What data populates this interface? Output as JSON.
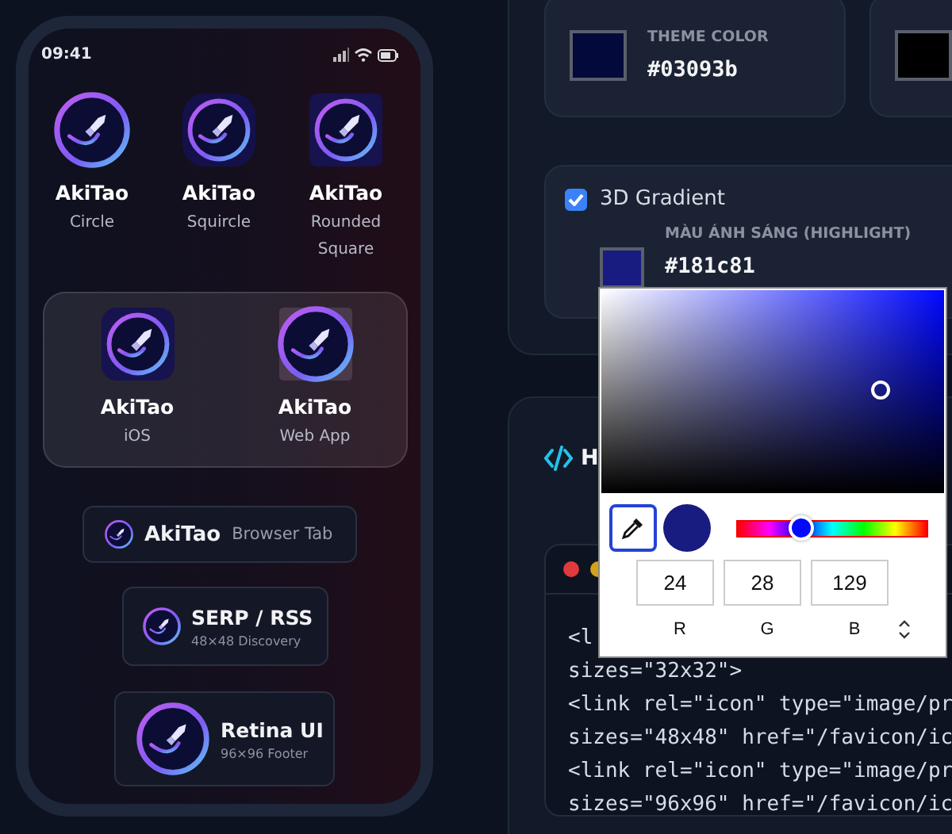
{
  "phone": {
    "time": "09:41",
    "icon_grid": [
      {
        "name": "AkiTao",
        "caption": "Circle",
        "kind": "circle"
      },
      {
        "name": "AkiTao",
        "caption": "Squircle",
        "kind": "squircle"
      },
      {
        "name": "AkiTao",
        "caption": "Rounded Square",
        "kind": "rounded"
      }
    ],
    "platform_group": [
      {
        "name": "AkiTao",
        "caption": "iOS",
        "kind": "ios"
      },
      {
        "name": "AkiTao",
        "caption": "Web App",
        "kind": "webapp"
      }
    ],
    "browser_tab": {
      "name": "AkiTao",
      "caption": "Browser Tab"
    },
    "previews": [
      {
        "title": "SERP / RSS",
        "caption": "48×48 Discovery",
        "kind": "medium"
      },
      {
        "title": "Retina UI",
        "caption": "96×96 Footer",
        "kind": "large"
      }
    ]
  },
  "colors": [
    {
      "label": "THEME COLOR",
      "value": "#03093b",
      "color": "#03093b"
    },
    {
      "color": "#000000"
    }
  ],
  "gradient": {
    "label": "3D Gradient",
    "checked": true,
    "highlight": {
      "label": "MÀU ÁNH SÁNG (HIGHLIGHT)",
      "value": "#181c81",
      "color": "#181c81"
    }
  },
  "code_panel": {
    "heading": "H",
    "lines": [
      "<l",
      "sizes=\"32x32\">",
      "<link rel=\"icon\" type=\"image/pr",
      "sizes=\"48x48\" href=\"/favicon/ic",
      "<link rel=\"icon\" type=\"image/pr",
      "sizes=\"96x96\" href=\"/favicon/ic"
    ]
  },
  "color_picker": {
    "color": "#181c81",
    "hue_slider": {
      "level": 0.34
    },
    "channels": [
      {
        "label": "R",
        "value": "24"
      },
      {
        "label": "G",
        "value": "28"
      },
      {
        "label": "B",
        "value": "129"
      }
    ]
  }
}
